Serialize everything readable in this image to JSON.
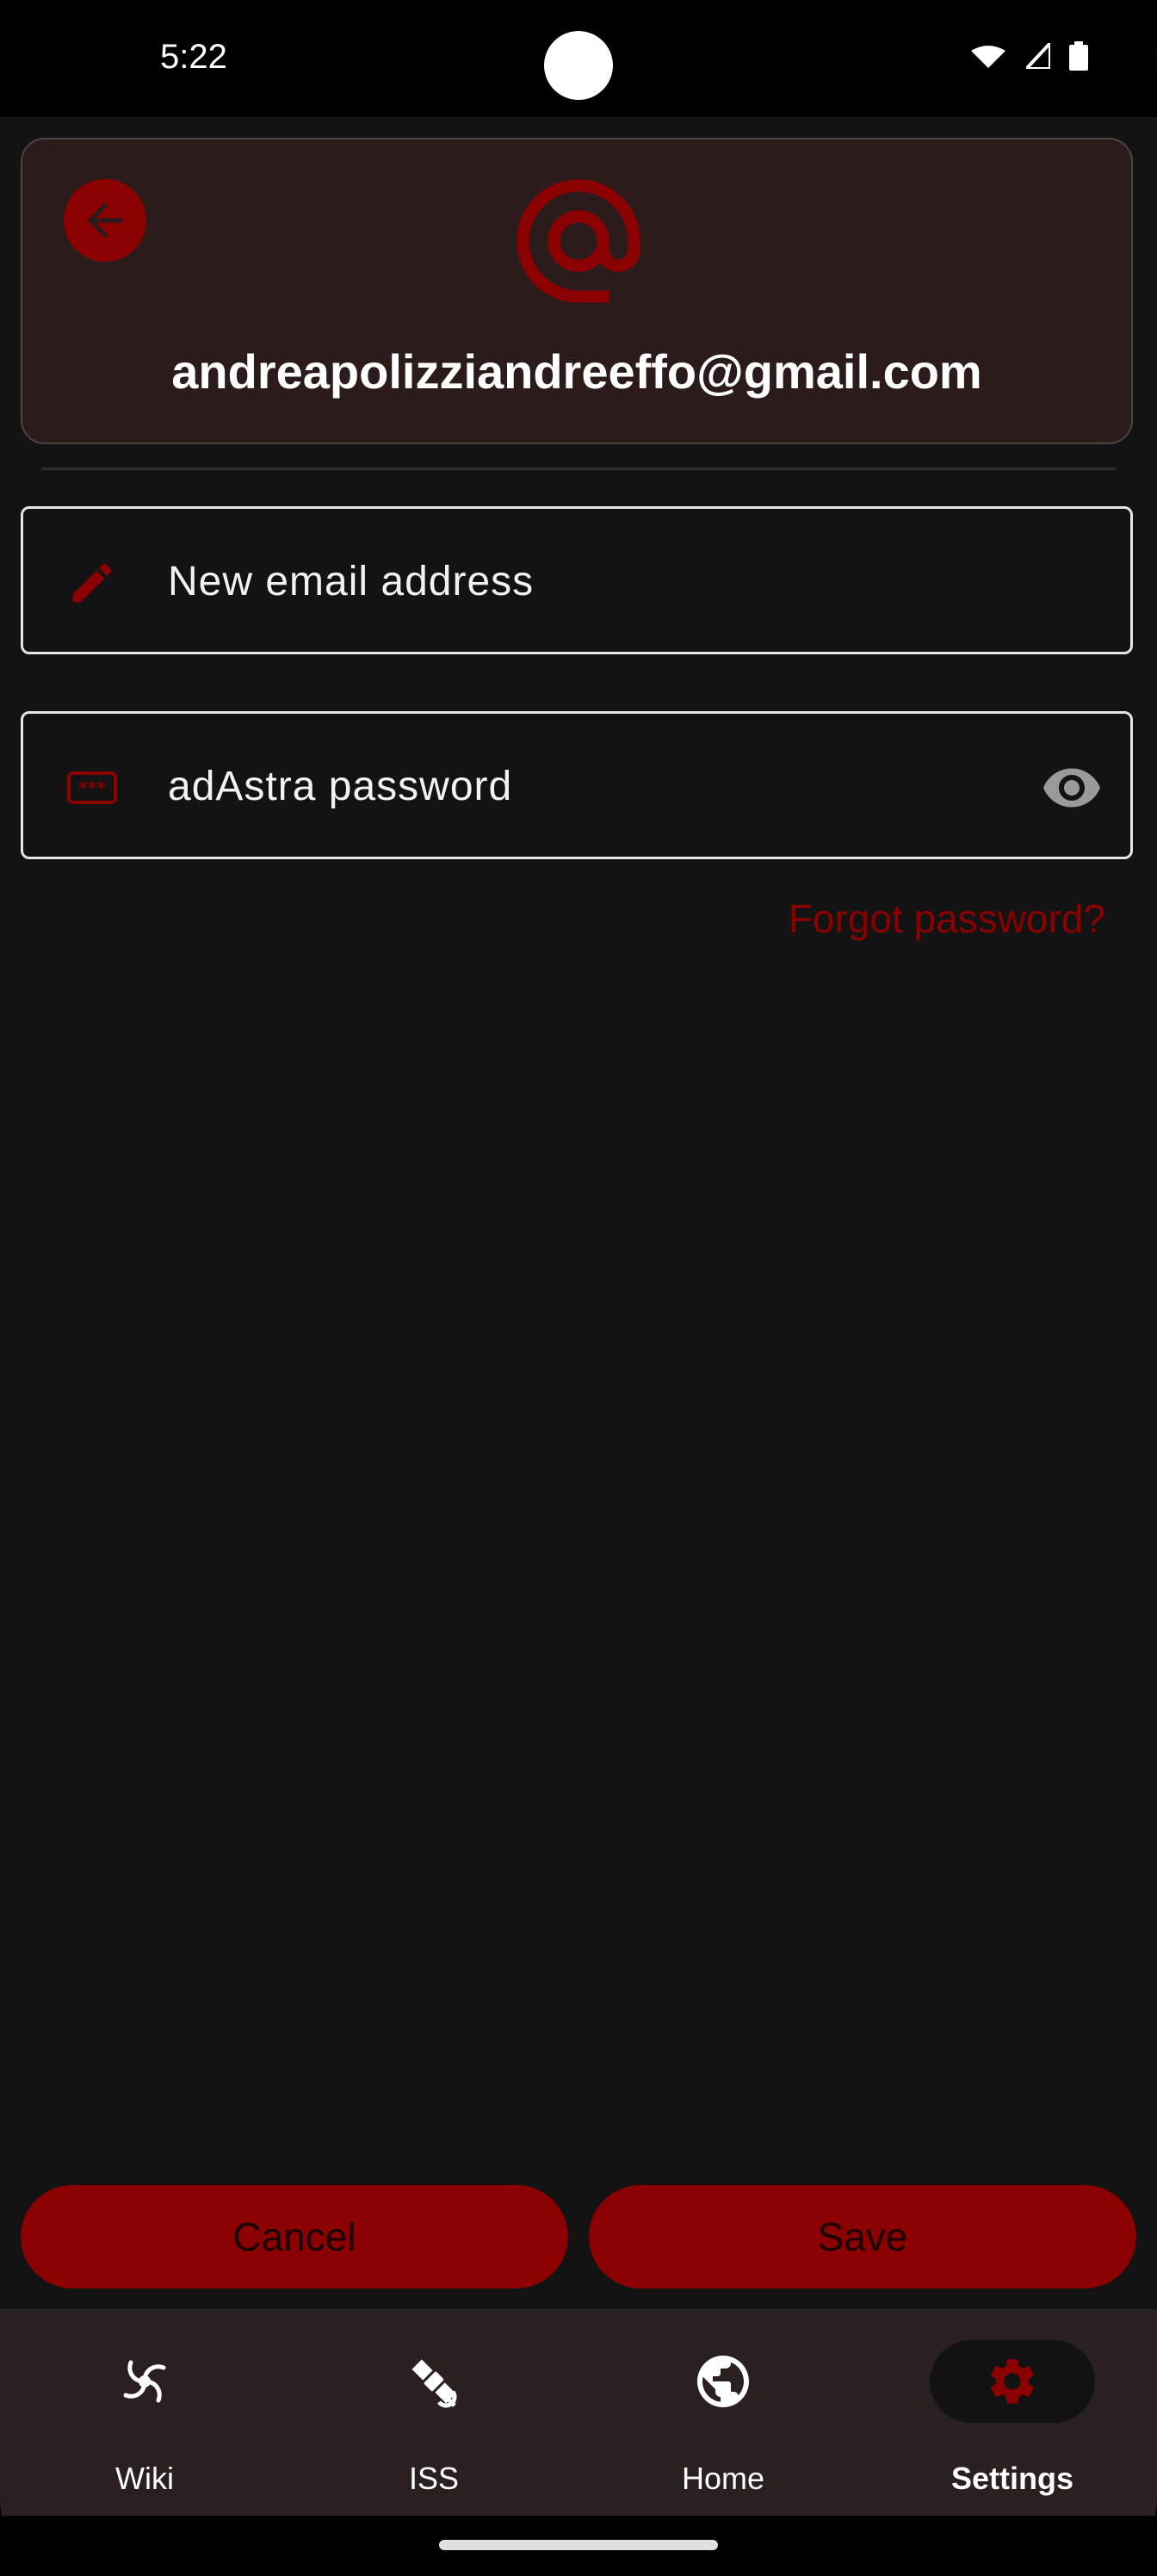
{
  "status_bar": {
    "time": "5:22"
  },
  "header": {
    "email": "andreapolizziandreeffo@gmail.com"
  },
  "form": {
    "new_email_placeholder": "New email address",
    "new_email_value": "",
    "password_placeholder": "adAstra password",
    "password_value": "",
    "forgot_password_label": "Forgot password?"
  },
  "actions": {
    "cancel_label": "Cancel",
    "save_label": "Save"
  },
  "nav": {
    "items": [
      {
        "label": "Wiki",
        "icon": "galaxy-icon"
      },
      {
        "label": "ISS",
        "icon": "satellite-icon"
      },
      {
        "label": "Home",
        "icon": "globe-icon"
      },
      {
        "label": "Settings",
        "icon": "gear-icon",
        "active": true
      }
    ]
  },
  "colors": {
    "accent": "#8b0000",
    "background": "#131313",
    "card": "#2c1b1b",
    "nav": "#2a2020"
  }
}
